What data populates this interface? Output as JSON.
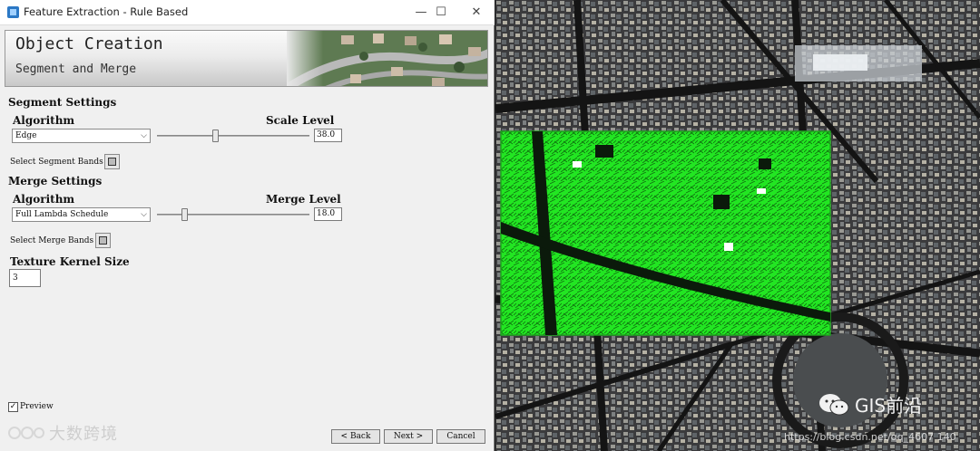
{
  "window": {
    "title": "Feature Extraction - Rule Based",
    "controls": [
      "—",
      "☐",
      "✕"
    ]
  },
  "banner": {
    "title": "Object Creation",
    "subtitle": "Segment and Merge"
  },
  "segment": {
    "heading": "Segment Settings",
    "algorithm_label": "Algorithm",
    "algorithm_value": "Edge",
    "level_label": "Scale Level",
    "level_value": "38.0",
    "level_fraction": 0.38,
    "bands_label": "Select Segment Bands"
  },
  "merge": {
    "heading": "Merge Settings",
    "algorithm_label": "Algorithm",
    "algorithm_value": "Full Lambda Schedule",
    "level_label": "Merge Level",
    "level_value": "18.0",
    "level_fraction": 0.18,
    "bands_label": "Select Merge Bands"
  },
  "texture": {
    "label": "Texture Kernel Size",
    "value": "3"
  },
  "preview": {
    "label": "Preview",
    "checked": true,
    "check_mark": "✓"
  },
  "buttons": {
    "back": "< Back",
    "next": "Next >",
    "cancel": "Cancel"
  },
  "watermarks": {
    "left_text": "大数跨境",
    "right_text": "GIS前沿",
    "url": "https://blog.csdn.net/qq_4607 140"
  },
  "colors": {
    "segmentation_overlay": "#22e622",
    "overlay_border": "#1fa01f"
  }
}
